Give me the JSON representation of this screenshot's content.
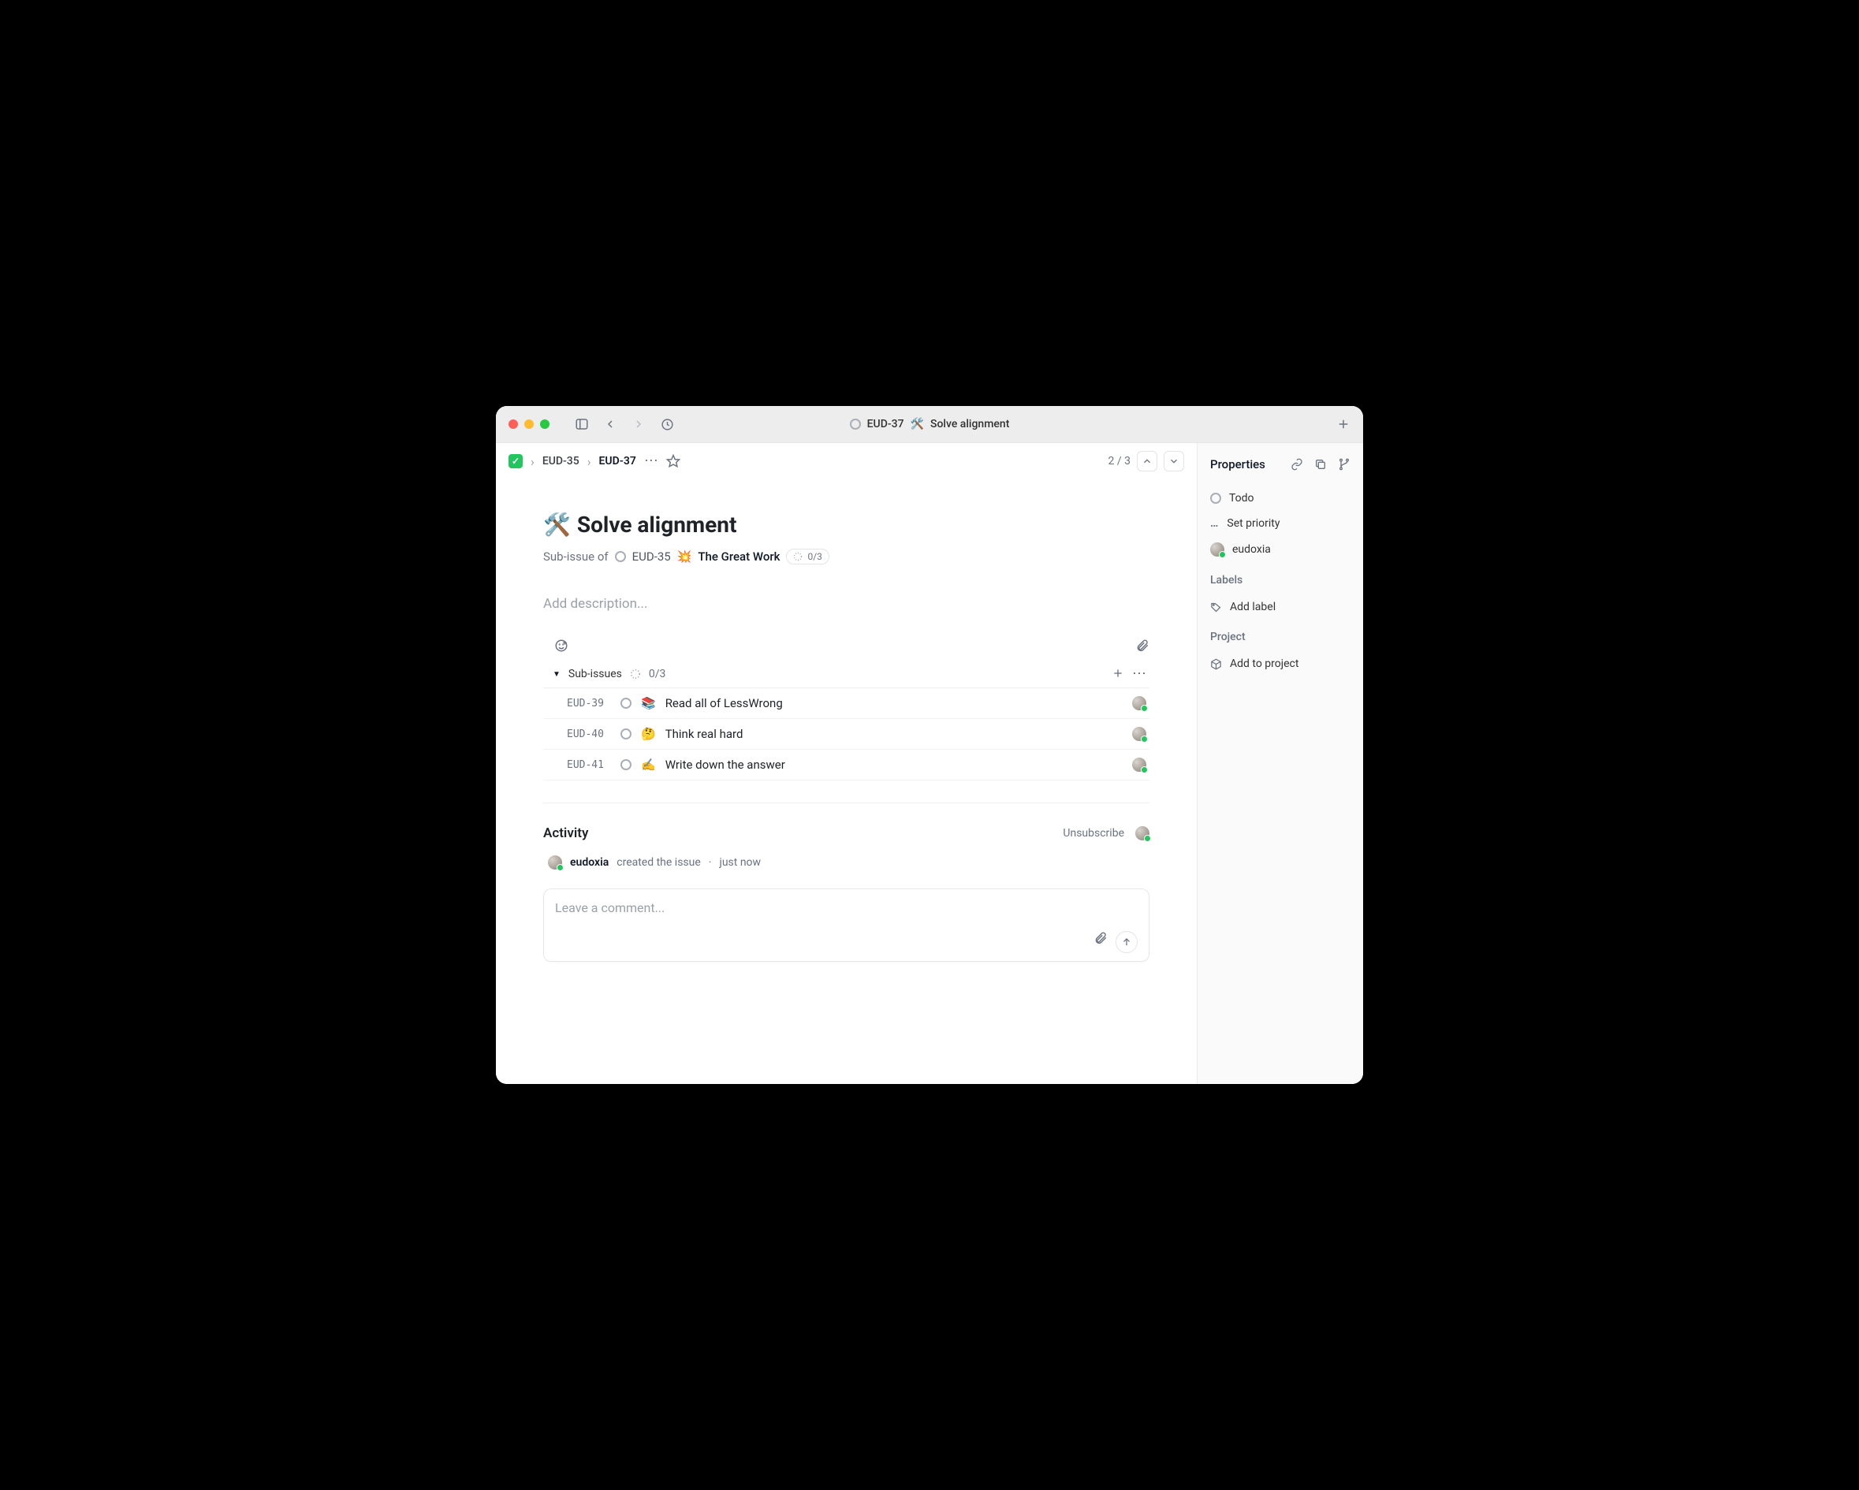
{
  "window": {
    "title_prefix": "EUD-37",
    "title_icon": "🛠️",
    "title_text": "Solve alignment"
  },
  "breadcrumb": {
    "parent": "EUD-35",
    "current": "EUD-37"
  },
  "pager": {
    "position": "2 / 3"
  },
  "issue": {
    "icon": "🛠️",
    "title": "Solve alignment",
    "sub_of_label": "Sub-issue of",
    "parent_id": "EUD-35",
    "parent_icon": "💥",
    "parent_title": "The Great Work",
    "parent_progress": "0/3",
    "description_placeholder": "Add description..."
  },
  "sub_issues": {
    "header": "Sub-issues",
    "progress": "0/3",
    "items": [
      {
        "id": "EUD-39",
        "icon": "📚",
        "title": "Read all of LessWrong"
      },
      {
        "id": "EUD-40",
        "icon": "🤔",
        "title": "Think real hard"
      },
      {
        "id": "EUD-41",
        "icon": "✍️",
        "title": "Write down the answer"
      }
    ]
  },
  "activity": {
    "header": "Activity",
    "unsubscribe": "Unsubscribe",
    "entries": [
      {
        "user": "eudoxia",
        "action": "created the issue",
        "time": "just now"
      }
    ],
    "comment_placeholder": "Leave a comment..."
  },
  "sidebar": {
    "header": "Properties",
    "status": "Todo",
    "priority": "Set priority",
    "assignee": "eudoxia",
    "labels_header": "Labels",
    "add_label": "Add label",
    "project_header": "Project",
    "add_project": "Add to project"
  }
}
